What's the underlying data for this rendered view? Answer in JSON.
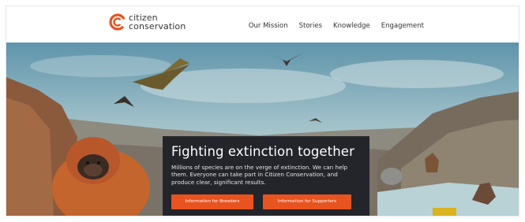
{
  "brand": {
    "line1": "citizen",
    "line2": "conservation",
    "accent": "#e8531f"
  },
  "nav": {
    "items": [
      "Our Mission",
      "Stories",
      "Knowledge",
      "Engagement"
    ]
  },
  "hero": {
    "title": "Fighting extinction together",
    "text": "Millions of species are on the verge of extinction. We can help them. Everyone can take part in Citizen Conservation, and produce clear, significant results.",
    "buttons": [
      "Information for Breeders",
      "Information for Supporters"
    ]
  }
}
